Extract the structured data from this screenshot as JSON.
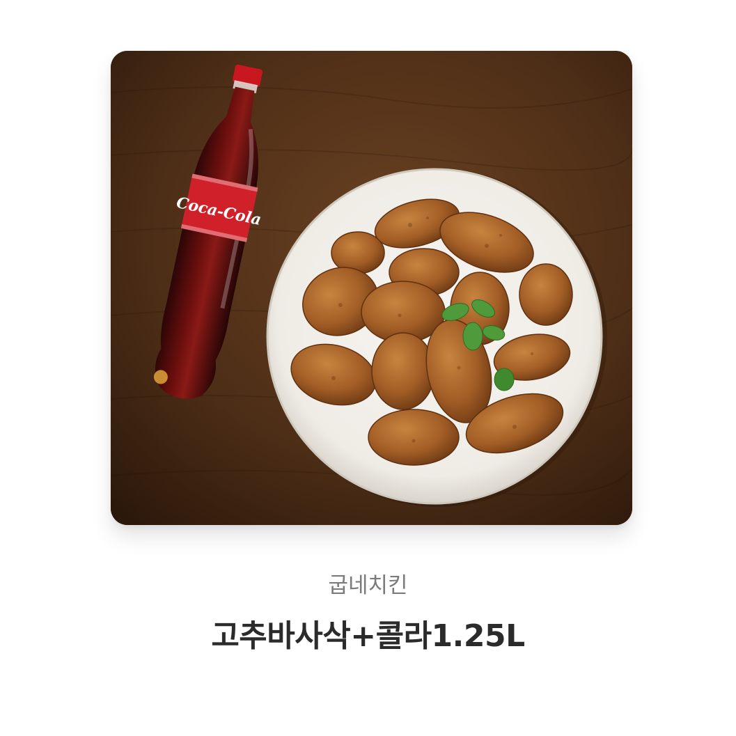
{
  "product": {
    "image_alt": "굽네치킨 고추바사삭+콜라1.25L",
    "brand": "굽네치킨",
    "name": "고추바사삭+콜라1.25L",
    "bottle_label": "Coca-Cola"
  },
  "colors": {
    "table": "#4a2c16",
    "plate": "#f4f2ee",
    "chicken": "#a8622a",
    "cola_red": "#d0202a",
    "brand_text": "#7b7b7b",
    "name_text": "#2b2b2b"
  }
}
